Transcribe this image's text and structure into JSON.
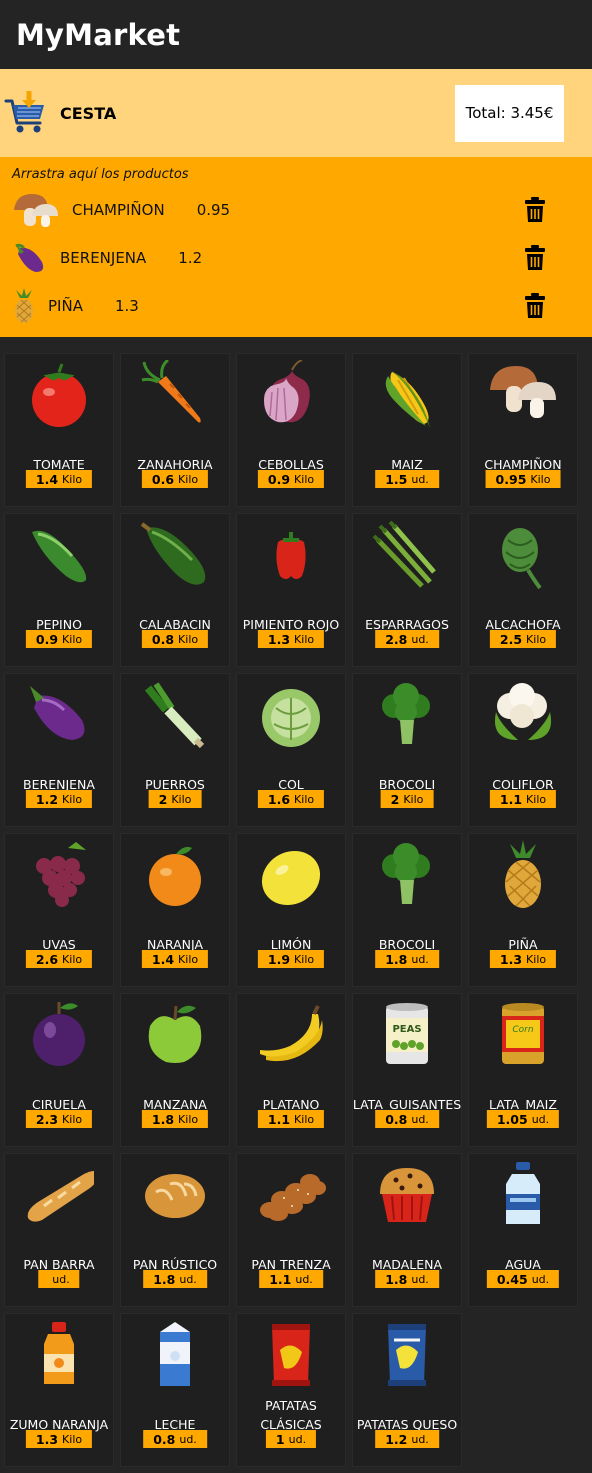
{
  "header": {
    "title": "MyMarket"
  },
  "cart": {
    "label": "CESTA",
    "total": "Total: 3.45€",
    "drop_hint": "Arrastra aquí los productos",
    "items": [
      {
        "name": "CHAMPIÑON",
        "price": "0.95",
        "icon": "mushroom"
      },
      {
        "name": "BERENJENA",
        "price": "1.2",
        "icon": "eggplant"
      },
      {
        "name": "PIÑA",
        "price": "1.3",
        "icon": "pineapple"
      }
    ]
  },
  "products": [
    {
      "name": "TOMATE",
      "price": "1.4",
      "unit": "Kilo",
      "icon": "tomato"
    },
    {
      "name": "ZANAHORIA",
      "price": "0.6",
      "unit": "Kilo",
      "icon": "carrot"
    },
    {
      "name": "CEBOLLAS",
      "price": "0.9",
      "unit": "Kilo",
      "icon": "onion"
    },
    {
      "name": "MAIZ",
      "price": "1.5",
      "unit": "ud.",
      "icon": "corn"
    },
    {
      "name": "CHAMPIÑON",
      "price": "0.95",
      "unit": "Kilo",
      "icon": "mushroom"
    },
    {
      "name": "PEPINO",
      "price": "0.9",
      "unit": "Kilo",
      "icon": "cucumber"
    },
    {
      "name": "CALABACIN",
      "price": "0.8",
      "unit": "Kilo",
      "icon": "zucchini"
    },
    {
      "name": "PIMIENTO ROJO",
      "price": "1.3",
      "unit": "Kilo",
      "icon": "red-pepper"
    },
    {
      "name": "ESPARRAGOS",
      "price": "2.8",
      "unit": "ud.",
      "icon": "asparagus"
    },
    {
      "name": "ALCACHOFA",
      "price": "2.5",
      "unit": "Kilo",
      "icon": "artichoke"
    },
    {
      "name": "BERENJENA",
      "price": "1.2",
      "unit": "Kilo",
      "icon": "eggplant"
    },
    {
      "name": "PUERROS",
      "price": "2",
      "unit": "Kilo",
      "icon": "leek"
    },
    {
      "name": "COL",
      "price": "1.6",
      "unit": "Kilo",
      "icon": "cabbage"
    },
    {
      "name": "BROCOLI",
      "price": "2",
      "unit": "Kilo",
      "icon": "broccoli"
    },
    {
      "name": "COLIFLOR",
      "price": "1.1",
      "unit": "Kilo",
      "icon": "cauliflower"
    },
    {
      "name": "UVAS",
      "price": "2.6",
      "unit": "Kilo",
      "icon": "grapes"
    },
    {
      "name": "NARANJA",
      "price": "1.4",
      "unit": "Kilo",
      "icon": "orange"
    },
    {
      "name": "LIMÓN",
      "price": "1.9",
      "unit": "Kilo",
      "icon": "lemon"
    },
    {
      "name": "BROCOLI",
      "price": "1.8",
      "unit": "ud.",
      "icon": "broccoli"
    },
    {
      "name": "PIÑA",
      "price": "1.3",
      "unit": "Kilo",
      "icon": "pineapple"
    },
    {
      "name": "CIRUELA",
      "price": "2.3",
      "unit": "Kilo",
      "icon": "plum"
    },
    {
      "name": "MANZANA",
      "price": "1.8",
      "unit": "Kilo",
      "icon": "apple"
    },
    {
      "name": "PLATANO",
      "price": "1.1",
      "unit": "Kilo",
      "icon": "banana"
    },
    {
      "name": "LATA_GUISANTES",
      "price": "0.8",
      "unit": "ud.",
      "icon": "peas-can",
      "can_label": "PEAS"
    },
    {
      "name": "LATA_MAIZ",
      "price": "1.05",
      "unit": "ud.",
      "icon": "corn-can",
      "can_label": "Corn"
    },
    {
      "name": "PAN BARRA",
      "price": "",
      "unit": "ud.",
      "icon": "baguette"
    },
    {
      "name": "PAN RÚSTICO",
      "price": "1.8",
      "unit": "ud.",
      "icon": "rustic-bread"
    },
    {
      "name": "PAN TRENZA",
      "price": "1.1",
      "unit": "ud.",
      "icon": "braided-bread"
    },
    {
      "name": "MADALENA",
      "price": "1.8",
      "unit": "ud.",
      "icon": "muffin"
    },
    {
      "name": "AGUA",
      "price": "0.45",
      "unit": "ud.",
      "icon": "water-bottle"
    },
    {
      "name": "ZUMO NARANJA",
      "price": "1.3",
      "unit": "Kilo",
      "icon": "orange-juice"
    },
    {
      "name": "LECHE",
      "price": "0.8",
      "unit": "ud.",
      "icon": "milk"
    },
    {
      "name": "PATATAS CLÁSICAS",
      "price": "1",
      "unit": "ud.",
      "icon": "chips-classic"
    },
    {
      "name": "PATATAS QUESO",
      "price": "1.2",
      "unit": "ud.",
      "icon": "chips-cheese"
    }
  ]
}
